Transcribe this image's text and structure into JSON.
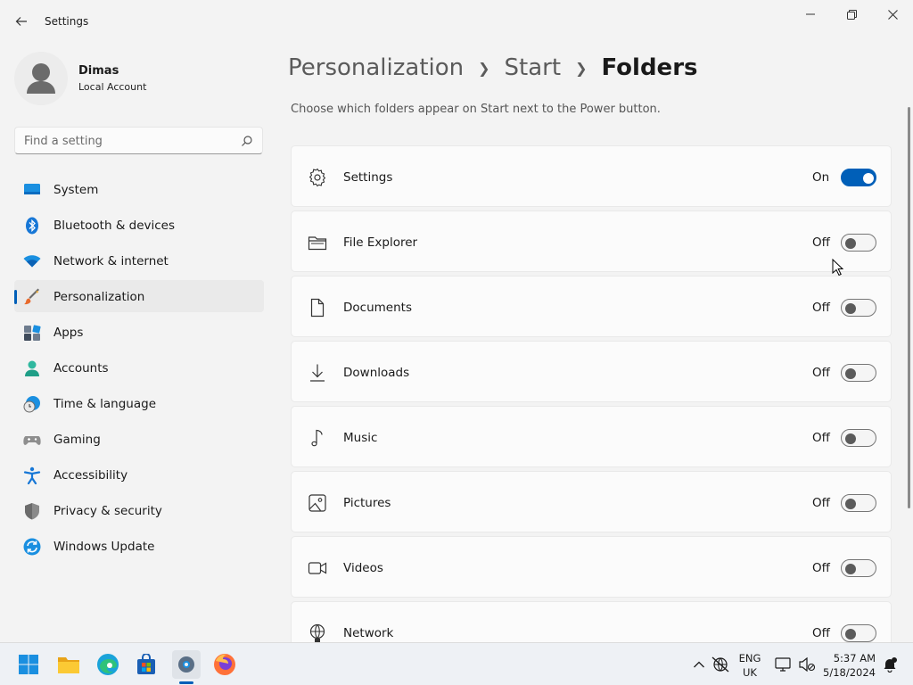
{
  "window": {
    "title": "Settings",
    "controls": [
      "minimize",
      "restore",
      "close"
    ]
  },
  "profile": {
    "name": "Dimas",
    "account_type": "Local Account"
  },
  "search": {
    "placeholder": "Find a setting"
  },
  "sidebar": {
    "items": [
      {
        "label": "System",
        "icon": "monitor-icon"
      },
      {
        "label": "Bluetooth & devices",
        "icon": "bluetooth-icon"
      },
      {
        "label": "Network & internet",
        "icon": "wifi-icon"
      },
      {
        "label": "Personalization",
        "icon": "paintbrush-icon",
        "active": true
      },
      {
        "label": "Apps",
        "icon": "apps-icon"
      },
      {
        "label": "Accounts",
        "icon": "person-icon"
      },
      {
        "label": "Time & language",
        "icon": "globe-clock-icon"
      },
      {
        "label": "Gaming",
        "icon": "gamepad-icon"
      },
      {
        "label": "Accessibility",
        "icon": "accessibility-icon"
      },
      {
        "label": "Privacy & security",
        "icon": "shield-icon"
      },
      {
        "label": "Windows Update",
        "icon": "sync-icon"
      }
    ]
  },
  "breadcrumb": {
    "items": [
      "Personalization",
      "Start",
      "Folders"
    ]
  },
  "description": "Choose which folders appear on Start next to the Power button.",
  "folders": [
    {
      "label": "Settings",
      "state": "On",
      "on": true,
      "icon": "gear-icon"
    },
    {
      "label": "File Explorer",
      "state": "Off",
      "on": false,
      "icon": "folder-icon"
    },
    {
      "label": "Documents",
      "state": "Off",
      "on": false,
      "icon": "document-icon"
    },
    {
      "label": "Downloads",
      "state": "Off",
      "on": false,
      "icon": "download-icon"
    },
    {
      "label": "Music",
      "state": "Off",
      "on": false,
      "icon": "music-note-icon"
    },
    {
      "label": "Pictures",
      "state": "Off",
      "on": false,
      "icon": "picture-icon"
    },
    {
      "label": "Videos",
      "state": "Off",
      "on": false,
      "icon": "video-icon"
    },
    {
      "label": "Network",
      "state": "Off",
      "on": false,
      "icon": "network-globe-icon"
    }
  ],
  "taskbar": {
    "apps": [
      "start",
      "file-explorer",
      "edge",
      "store",
      "settings",
      "firefox"
    ],
    "language": {
      "line1": "ENG",
      "line2": "UK"
    },
    "time": "5:37 AM",
    "date": "5/18/2024"
  },
  "colors": {
    "accent": "#005fb8",
    "background": "#f3f3f3",
    "card": "#fbfbfb"
  }
}
